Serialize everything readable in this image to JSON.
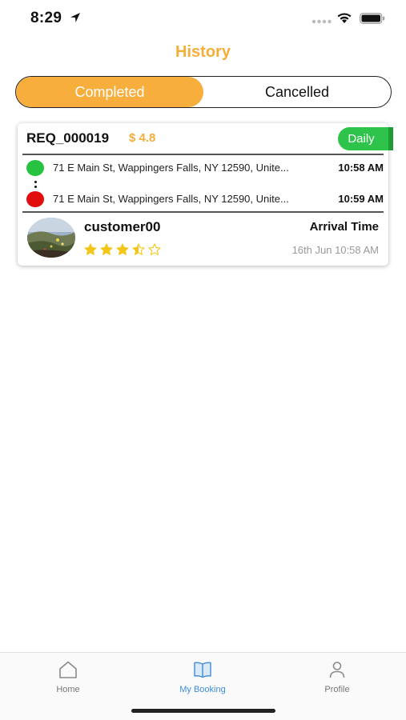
{
  "status_bar": {
    "time": "8:29"
  },
  "page": {
    "title": "History"
  },
  "tabs": [
    {
      "label": "Completed",
      "active": true
    },
    {
      "label": "Cancelled",
      "active": false
    }
  ],
  "booking": {
    "request_id": "REQ_000019",
    "price": "$ 4.8",
    "badge": "Daily",
    "pickup": {
      "address": "71 E Main St, Wappingers Falls, NY  12590, Unite...",
      "time": "10:58 AM"
    },
    "drop": {
      "address": "71 E Main St, Wappingers Falls, NY  12590, Unite...",
      "time": "10:59 AM"
    },
    "customer_name": "customer00",
    "rating": 3.5,
    "rating_max": 5,
    "arrival_label": "Arrival Time",
    "arrival_time": "16th Jun 10:58 AM"
  },
  "bottom_nav": [
    {
      "label": "Home",
      "icon": "home-icon"
    },
    {
      "label": "My Booking",
      "icon": "book-icon",
      "active": true
    },
    {
      "label": "Profile",
      "icon": "person-icon"
    }
  ],
  "colors": {
    "accent": "#f8ae3d",
    "green": "#2ec34b",
    "red": "#e20e0e",
    "nav_active": "#3a8de0"
  }
}
